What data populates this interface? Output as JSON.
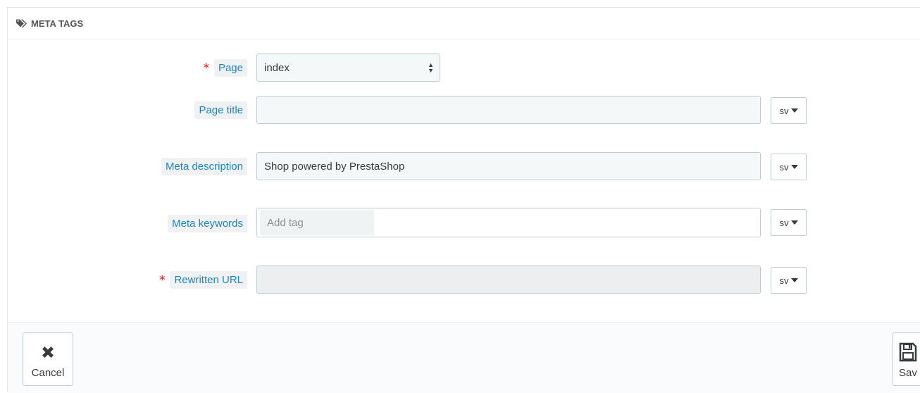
{
  "panel": {
    "title": "META TAGS",
    "icon": "tags-icon"
  },
  "fields": {
    "page": {
      "label": "Page",
      "required": true,
      "value": "index"
    },
    "page_title": {
      "label": "Page title",
      "value": "",
      "lang": "sv"
    },
    "meta_description": {
      "label": "Meta description",
      "value": "Shop powered by PrestaShop",
      "lang": "sv"
    },
    "meta_keywords": {
      "label": "Meta keywords",
      "placeholder": "Add tag",
      "lang": "sv"
    },
    "rewritten_url": {
      "label": "Rewritten URL",
      "required": true,
      "value": "",
      "lang": "sv"
    }
  },
  "footer": {
    "cancel_label": "Cancel",
    "save_label": "Sav"
  },
  "colors": {
    "label_text": "#1f85b9",
    "required": "#e40f0f",
    "input_border": "#bbcdd2"
  }
}
